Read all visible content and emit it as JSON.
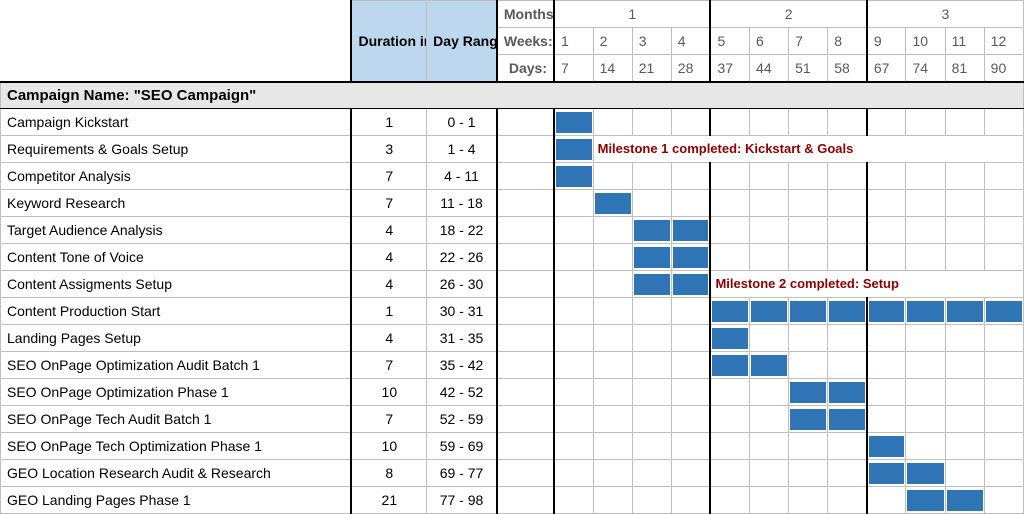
{
  "headers": {
    "duration": "Duration in Days",
    "range": "Day Range",
    "months_label": "Months:",
    "weeks_label": "Weeks:",
    "days_label": "Days:",
    "months": [
      "1",
      "2",
      "3"
    ],
    "weeks": [
      "1",
      "2",
      "3",
      "4",
      "5",
      "6",
      "7",
      "8",
      "9",
      "10",
      "11",
      "12"
    ],
    "days": [
      "7",
      "14",
      "21",
      "28",
      "37",
      "44",
      "51",
      "58",
      "67",
      "74",
      "81",
      "90"
    ]
  },
  "campaign_title": "Campaign Name: \"SEO Campaign\"",
  "milestones": {
    "m1": "Milestone 1 completed: Kickstart & Goals",
    "m2": "Milestone 2 completed: Setup"
  },
  "tasks": [
    {
      "name": "Campaign Kickstart",
      "duration": "1",
      "range": "0 - 1"
    },
    {
      "name": "Requirements & Goals Setup",
      "duration": "3",
      "range": "1 - 4"
    },
    {
      "name": "Competitor Analysis",
      "duration": "7",
      "range": "4 - 11"
    },
    {
      "name": "Keyword Research",
      "duration": "7",
      "range": "11 - 18"
    },
    {
      "name": "Target Audience Analysis",
      "duration": "4",
      "range": "18 - 22"
    },
    {
      "name": "Content Tone of Voice",
      "duration": "4",
      "range": "22 - 26"
    },
    {
      "name": "Content Assigments Setup",
      "duration": "4",
      "range": "26 - 30"
    },
    {
      "name": "Content Production Start",
      "duration": "1",
      "range": "30 - 31"
    },
    {
      "name": "Landing Pages Setup",
      "duration": "4",
      "range": "31 - 35"
    },
    {
      "name": "SEO OnPage Optimization Audit Batch 1",
      "duration": "7",
      "range": "35 - 42"
    },
    {
      "name": "SEO OnPage Optimization Phase 1",
      "duration": "10",
      "range": "42 - 52"
    },
    {
      "name": "SEO OnPage Tech Audit Batch 1",
      "duration": "7",
      "range": "52 - 59"
    },
    {
      "name": "SEO OnPage Tech Optimization Phase 1",
      "duration": "10",
      "range": "59 - 69"
    },
    {
      "name": "GEO Location Research Audit & Research",
      "duration": "8",
      "range": "69 - 77"
    },
    {
      "name": "GEO Landing Pages Phase 1",
      "duration": "21",
      "range": "77 - 98"
    }
  ],
  "chart_data": {
    "type": "gantt",
    "title": "Campaign Name: \"SEO Campaign\"",
    "x_unit": "days",
    "x_columns": [
      7,
      14,
      21,
      28,
      37,
      44,
      51,
      58,
      67,
      74,
      81,
      90
    ],
    "week_columns": [
      1,
      2,
      3,
      4,
      5,
      6,
      7,
      8,
      9,
      10,
      11,
      12
    ],
    "month_groups": [
      1,
      2,
      3
    ],
    "tasks": [
      {
        "name": "Campaign Kickstart",
        "start": 0,
        "end": 1,
        "duration": 1,
        "bar_weeks": [
          1
        ]
      },
      {
        "name": "Requirements & Goals Setup",
        "start": 1,
        "end": 4,
        "duration": 3,
        "bar_weeks": [
          1
        ]
      },
      {
        "name": "Competitor Analysis",
        "start": 4,
        "end": 11,
        "duration": 7,
        "bar_weeks": [
          1
        ]
      },
      {
        "name": "Keyword Research",
        "start": 11,
        "end": 18,
        "duration": 7,
        "bar_weeks": [
          2
        ]
      },
      {
        "name": "Target Audience Analysis",
        "start": 18,
        "end": 22,
        "duration": 4,
        "bar_weeks": [
          3,
          4
        ]
      },
      {
        "name": "Content Tone of Voice",
        "start": 22,
        "end": 26,
        "duration": 4,
        "bar_weeks": [
          3,
          4
        ]
      },
      {
        "name": "Content Assigments Setup",
        "start": 26,
        "end": 30,
        "duration": 4,
        "bar_weeks": [
          3,
          4
        ]
      },
      {
        "name": "Content Production Start",
        "start": 30,
        "end": 31,
        "duration": 1,
        "bar_weeks": [
          5,
          6,
          7,
          8,
          9,
          10,
          11,
          12
        ]
      },
      {
        "name": "Landing Pages Setup",
        "start": 31,
        "end": 35,
        "duration": 4,
        "bar_weeks": [
          5
        ]
      },
      {
        "name": "SEO OnPage Optimization Audit Batch 1",
        "start": 35,
        "end": 42,
        "duration": 7,
        "bar_weeks": [
          5,
          6
        ]
      },
      {
        "name": "SEO OnPage Optimization Phase 1",
        "start": 42,
        "end": 52,
        "duration": 10,
        "bar_weeks": [
          7,
          8
        ]
      },
      {
        "name": "SEO OnPage Tech Audit Batch 1",
        "start": 52,
        "end": 59,
        "duration": 7,
        "bar_weeks": [
          7,
          8
        ]
      },
      {
        "name": "SEO OnPage Tech Optimization Phase 1",
        "start": 59,
        "end": 69,
        "duration": 10,
        "bar_weeks": [
          9
        ]
      },
      {
        "name": "GEO Location Research Audit & Research",
        "start": 69,
        "end": 77,
        "duration": 8,
        "bar_weeks": [
          9,
          10
        ]
      },
      {
        "name": "GEO Landing Pages Phase 1",
        "start": 77,
        "end": 98,
        "duration": 21,
        "bar_weeks": [
          10,
          11
        ]
      }
    ],
    "milestones": [
      {
        "label": "Milestone 1 completed: Kickstart & Goals",
        "after_task": "Requirements & Goals Setup",
        "display_week": 2
      },
      {
        "label": "Milestone 2 completed: Setup",
        "after_task": "Content Assigments Setup",
        "display_week": 5
      }
    ]
  }
}
